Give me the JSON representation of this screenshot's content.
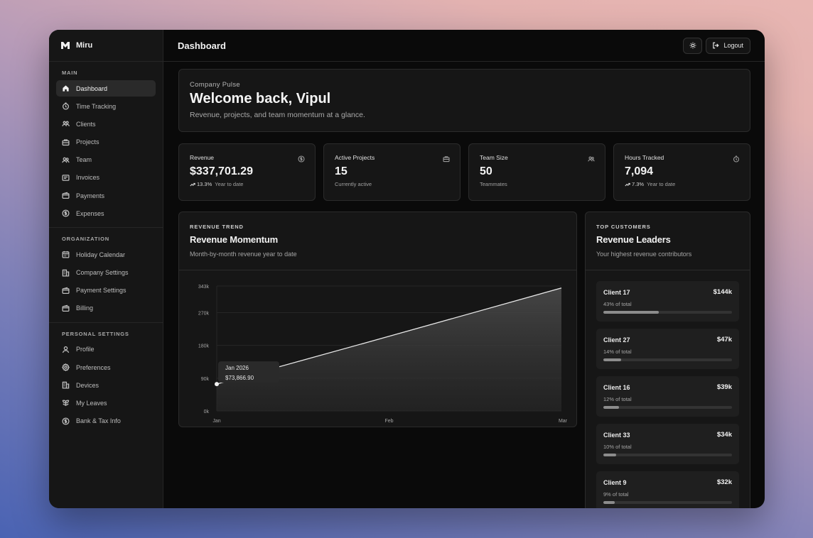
{
  "brand": {
    "name": "Miru"
  },
  "sidebar": {
    "sections": [
      {
        "title": "MAIN",
        "items": [
          {
            "label": "Dashboard",
            "icon": "home-icon",
            "active": true
          },
          {
            "label": "Time Tracking",
            "icon": "timer-icon"
          },
          {
            "label": "Clients",
            "icon": "clients-icon"
          },
          {
            "label": "Projects",
            "icon": "briefcase-icon"
          },
          {
            "label": "Team",
            "icon": "team-icon"
          },
          {
            "label": "Invoices",
            "icon": "invoice-icon"
          },
          {
            "label": "Payments",
            "icon": "wallet-icon"
          },
          {
            "label": "Expenses",
            "icon": "dollar-icon"
          }
        ]
      },
      {
        "title": "ORGANIZATION",
        "items": [
          {
            "label": "Holiday Calendar",
            "icon": "calendar-icon"
          },
          {
            "label": "Company Settings",
            "icon": "building-icon"
          },
          {
            "label": "Payment Settings",
            "icon": "wallet-icon"
          },
          {
            "label": "Billing",
            "icon": "wallet-icon"
          }
        ]
      },
      {
        "title": "PERSONAL SETTINGS",
        "items": [
          {
            "label": "Profile",
            "icon": "user-icon"
          },
          {
            "label": "Preferences",
            "icon": "gear-icon"
          },
          {
            "label": "Devices",
            "icon": "building-icon"
          },
          {
            "label": "My Leaves",
            "icon": "leaves-icon"
          },
          {
            "label": "Bank & Tax Info",
            "icon": "dollar-icon"
          }
        ]
      }
    ]
  },
  "header": {
    "title": "Dashboard",
    "logout_label": "Logout"
  },
  "welcome": {
    "eyebrow": "Company Pulse",
    "title": "Welcome back, Vipul",
    "subtitle": "Revenue, projects, and team momentum at a glance."
  },
  "stats": [
    {
      "label": "Revenue",
      "value": "$337,701.29",
      "trend": "13.3%",
      "note": "Year to date",
      "icon": "dollar-icon"
    },
    {
      "label": "Active Projects",
      "value": "15",
      "trend": "",
      "note": "Currently active",
      "icon": "briefcase-icon"
    },
    {
      "label": "Team Size",
      "value": "50",
      "trend": "",
      "note": "Teammates",
      "icon": "team-icon"
    },
    {
      "label": "Hours Tracked",
      "value": "7,094",
      "trend": "7.3%",
      "note": "Year to date",
      "icon": "timer-icon"
    }
  ],
  "revenue_trend": {
    "eyebrow": "REVENUE TREND",
    "title": "Revenue Momentum",
    "description": "Month-by-month revenue year to date",
    "tooltip": {
      "label": "Jan 2026",
      "value": "$73,866.90"
    }
  },
  "chart_data": {
    "type": "area",
    "categories": [
      "Jan",
      "Feb",
      "Mar"
    ],
    "values": [
      73866.9,
      205000,
      337701.29
    ],
    "ylim": [
      0,
      343000
    ],
    "yticks": [
      "0k",
      "90k",
      "180k",
      "270k",
      "343k"
    ],
    "ytick_values": [
      0,
      90000,
      180000,
      270000,
      343000
    ],
    "grid": true
  },
  "top_customers": {
    "eyebrow": "TOP CUSTOMERS",
    "title": "Revenue Leaders",
    "description": "Your highest revenue contributors",
    "items": [
      {
        "name": "Client 17",
        "amount": "$144k",
        "share_label": "43% of total",
        "share": 0.43
      },
      {
        "name": "Client 27",
        "amount": "$47k",
        "share_label": "14% of total",
        "share": 0.14
      },
      {
        "name": "Client 16",
        "amount": "$39k",
        "share_label": "12% of total",
        "share": 0.12
      },
      {
        "name": "Client 33",
        "amount": "$34k",
        "share_label": "10% of total",
        "share": 0.1
      },
      {
        "name": "Client 9",
        "amount": "$32k",
        "share_label": "9% of total",
        "share": 0.09
      }
    ]
  }
}
